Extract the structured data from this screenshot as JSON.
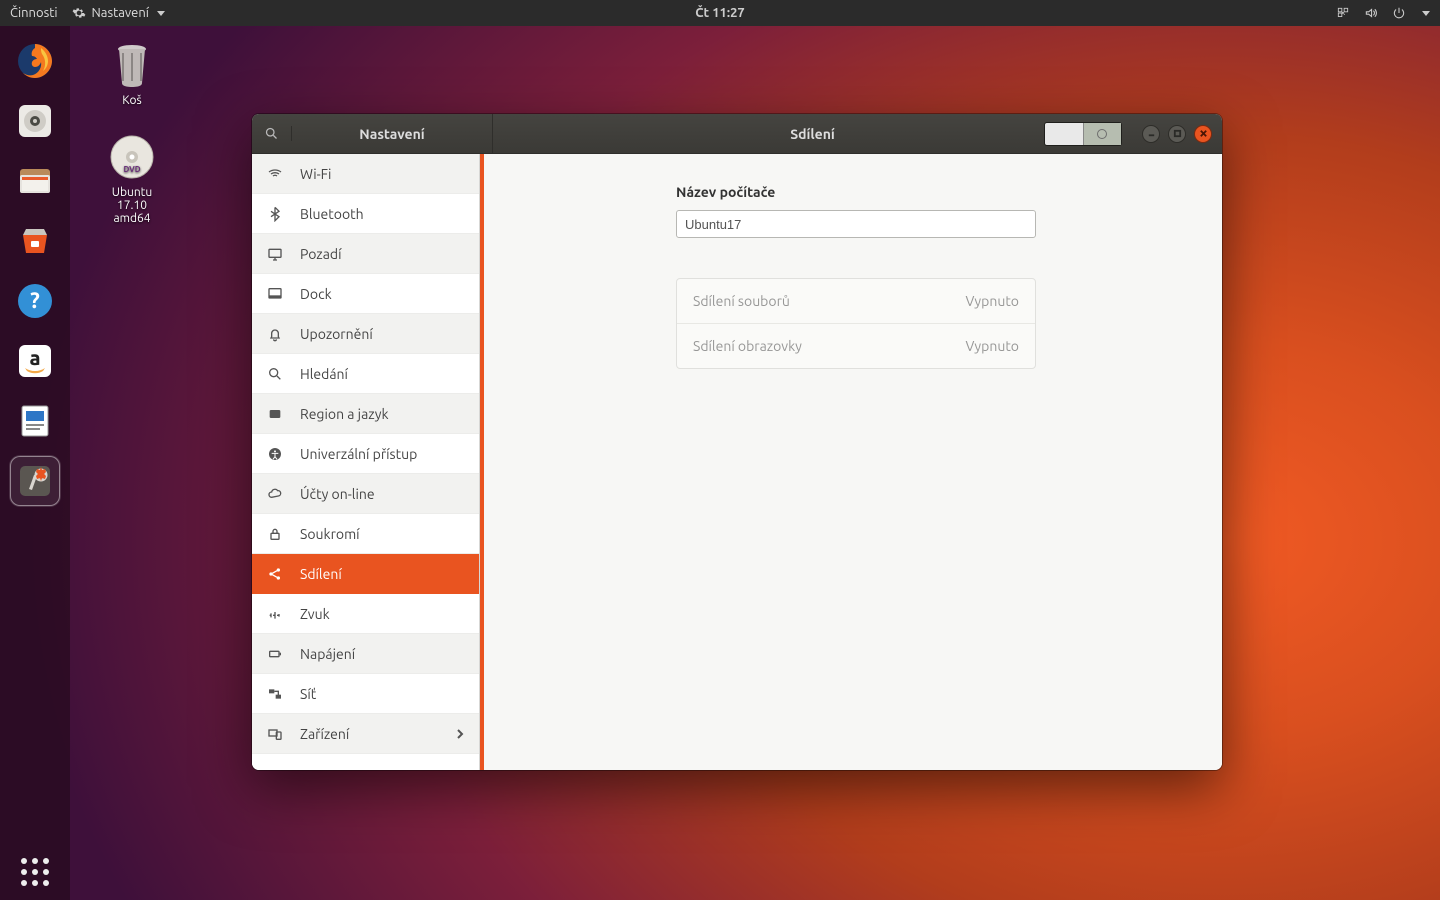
{
  "panel": {
    "activities": "Činnosti",
    "app_name": "Nastavení",
    "clock": "Čt 11:27"
  },
  "desktop": {
    "trash": "Koš",
    "dvd_line1": "Ubuntu",
    "dvd_line2": "17.10",
    "dvd_line3": "amd64"
  },
  "window": {
    "sidebar_title": "Nastavení",
    "panel_title": "Sdílení",
    "toggle_state": "off"
  },
  "sidebar": {
    "items": [
      {
        "label": "Wi-Fi"
      },
      {
        "label": "Bluetooth"
      },
      {
        "label": "Pozadí"
      },
      {
        "label": "Dock"
      },
      {
        "label": "Upozornění"
      },
      {
        "label": "Hledání"
      },
      {
        "label": "Region a jazyk"
      },
      {
        "label": "Univerzální přístup"
      },
      {
        "label": "Účty on-line"
      },
      {
        "label": "Soukromí"
      },
      {
        "label": "Sdílení"
      },
      {
        "label": "Zvuk"
      },
      {
        "label": "Napájení"
      },
      {
        "label": "Síť"
      },
      {
        "label": "Zařízení"
      }
    ]
  },
  "sharing": {
    "hostname_label": "Název počítače",
    "hostname_value": "Ubuntu17",
    "rows": [
      {
        "name": "Sdílení souborů",
        "state": "Vypnuto"
      },
      {
        "name": "Sdílení obrazovky",
        "state": "Vypnuto"
      }
    ]
  }
}
